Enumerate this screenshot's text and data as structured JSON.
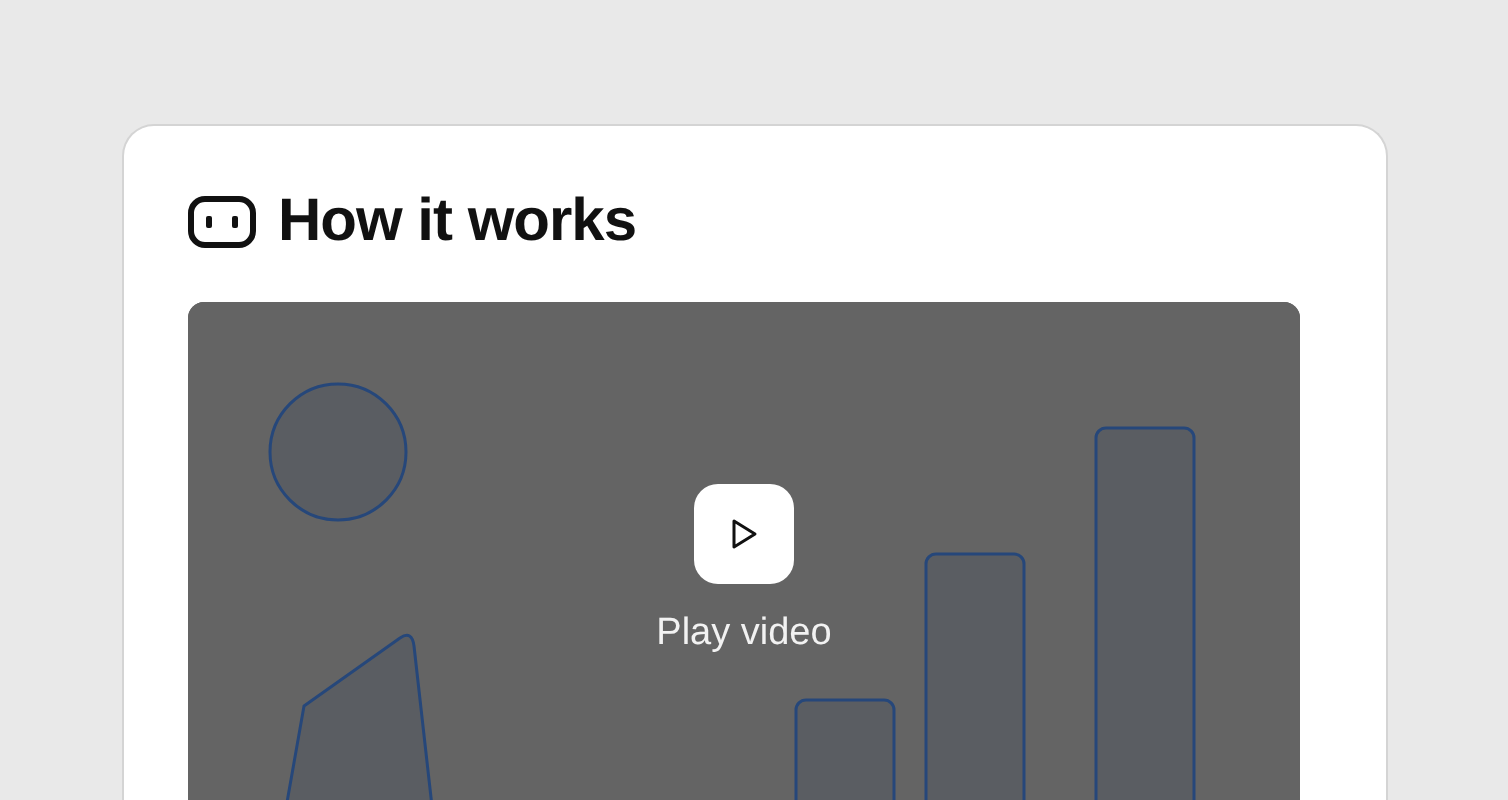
{
  "section": {
    "title": "How it works"
  },
  "video": {
    "play_label": "Play video"
  }
}
